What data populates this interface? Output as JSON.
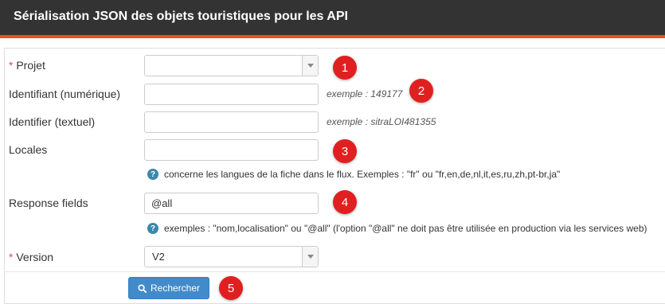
{
  "header": {
    "title": "Sérialisation JSON des objets touristiques pour les API"
  },
  "form": {
    "projet": {
      "required_mark": "*",
      "label": " Projet",
      "value": ""
    },
    "identifiant": {
      "label": "Identifiant (numérique)",
      "value": "",
      "example": "exemple : 149177"
    },
    "identifier": {
      "label": "Identifier (textuel)",
      "value": "",
      "example": "exemple : sitraLOI481355"
    },
    "locales": {
      "label": "Locales",
      "value": "",
      "help": "concerne les langues de la fiche dans le flux. Exemples : \"fr\" ou \"fr,en,de,nl,it,es,ru,zh,pt-br,ja\""
    },
    "response_fields": {
      "label": "Response fields",
      "value": "@all",
      "help": "exemples : \"nom,localisation\" ou \"@all\" (l'option \"@all\" ne doit pas être utilisée en production via les services web)"
    },
    "version": {
      "required_mark": "*",
      "label": " Version",
      "value": "V2"
    },
    "submit_label": "Rechercher"
  },
  "annotations": [
    "1",
    "2",
    "3",
    "4",
    "5"
  ],
  "colors": {
    "header_bg": "#333333",
    "header_accent": "#e8501c",
    "button": "#428bca",
    "badge": "#e02020",
    "required": "#d9534f"
  },
  "icons": {
    "help": "question-circle-icon",
    "search": "search-icon",
    "select": "chevron-down-icon"
  }
}
